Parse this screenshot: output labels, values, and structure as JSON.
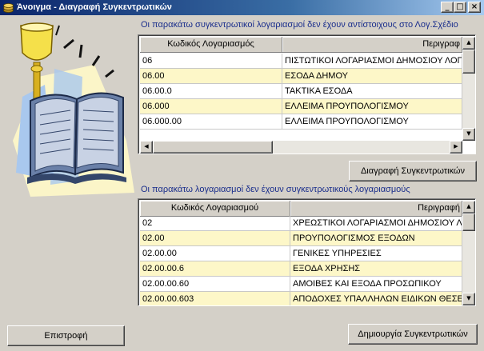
{
  "window": {
    "title": "Άνοιγμα - Διαγραφή Συγκεντρωτικών",
    "minimize_glyph": "_",
    "maximize_glyph": "□",
    "close_glyph": "×",
    "app_icon": "coin-stack-icon"
  },
  "illustration": {
    "icon": "open-book-with-candle-icon"
  },
  "top_section": {
    "caption": "Οι παρακάτω συγκεντρωτικοί λογαριασμοί δεν έχουν αντίστοιχους στο Λογ.Σχέδιο",
    "columns": [
      "Κωδικός Λογαριασμός",
      "Περιγραφ"
    ],
    "rows": [
      {
        "code": "06",
        "description": "ΠΙΣΤΩΤΙΚΟΙ ΛΟΓΑΡΙΑΣΜΟΙ ΔΗΜΟΣΙΟΥ ΛΟΓΙΣΤΙΚ"
      },
      {
        "code": "06.00",
        "description": "ΕΣΟΔΑ ΔΗΜΟΥ"
      },
      {
        "code": "06.00.0",
        "description": "ΤΑΚΤΙΚΑ ΕΣΟΔΑ"
      },
      {
        "code": "06.000",
        "description": "ΕΛΛΕΙΜΑ ΠΡΟΥΠΟΛΟΓΙΣΜΟΥ"
      },
      {
        "code": "06.000.00",
        "description": "ΕΛΛΕΙΜΑ ΠΡΟΥΠΟΛΟΓΙΣΜΟΥ"
      }
    ],
    "delete_button_label": "Διαγραφή Συγκεντρωτικών"
  },
  "bottom_section": {
    "caption": "Οι παρακάτω λογαριασμοί δεν έχουν συγκεντρωτικούς λογαριασμούς",
    "columns": [
      "Κωδικός Λογαριασμού",
      "Περιγραφή"
    ],
    "rows": [
      {
        "code": "02",
        "description": "ΧΡΕΩΣΤΙΚΟΙ ΛΟΓΑΡΙΑΣΜΟΙ ΔΗΜΟΣΙΟΥ ΛΟΓΙΣ"
      },
      {
        "code": "02.00",
        "description": "ΠΡΟΥΠΟΛΟΓΙΣΜΟΣ ΕΞΟΔΩΝ"
      },
      {
        "code": "02.00.00",
        "description": "ΓΕΝΙΚΕΣ ΥΠΗΡΕΣΙΕΣ"
      },
      {
        "code": "02.00.00.6",
        "description": "ΕΞΟΔΑ ΧΡΗΣΗΣ"
      },
      {
        "code": "02.00.00.60",
        "description": "ΑΜΟΙΒΕΣ ΚΑΙ ΕΞΟΔΑ ΠΡΟΣΩΠΙΚΟΥ"
      },
      {
        "code": "02.00.00.603",
        "description": "ΑΠΟΔΟΧΕΣ ΥΠΑΛΛΗΛΩΝ ΕΙΔΙΚΩΝ ΘΕΣΕΩΝ"
      }
    ],
    "create_button_label": "Δημιουργία Συγκεντρωτικών"
  },
  "return_button_label": "Επιστροφή",
  "colors": {
    "title_start": "#0a246a",
    "title_end": "#a6caf0",
    "caption_text": "#1a2e8c",
    "row_highlight": "#fdf7c8",
    "face": "#d4d0c8"
  }
}
